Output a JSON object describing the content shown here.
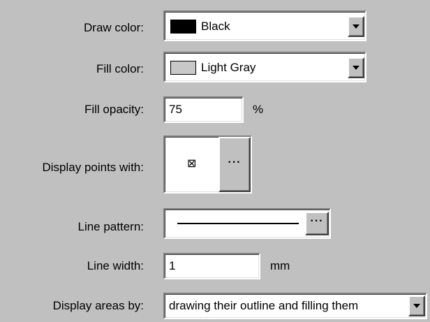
{
  "labels": {
    "draw_color": "Draw color:",
    "fill_color": "Fill color:",
    "fill_opacity": "Fill opacity:",
    "display_points": "Display points with:",
    "line_pattern": "Line pattern:",
    "line_width": "Line width:",
    "display_areas": "Display areas by:"
  },
  "draw_color": {
    "value": "Black",
    "swatch": "#000000"
  },
  "fill_color": {
    "value": "Light Gray",
    "swatch": "#c8c8c8"
  },
  "fill_opacity": {
    "value": "75",
    "unit": "%"
  },
  "display_points": {
    "symbol": "⊠",
    "browse": "···"
  },
  "line_pattern": {
    "browse": "···"
  },
  "line_width": {
    "value": "1",
    "unit": "mm"
  },
  "display_areas": {
    "value": "drawing their outline and filling them"
  },
  "colors": {
    "face": "#c0c0c0",
    "field": "#ffffff"
  }
}
